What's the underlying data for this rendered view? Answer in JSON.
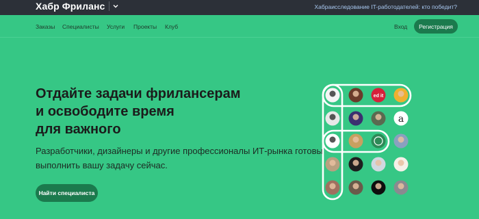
{
  "header": {
    "brand": "Хабр Фриланс",
    "top_link": "Хабраисследование IT-работодателей: кто победит?"
  },
  "nav": {
    "items": [
      "Заказы",
      "Специалисты",
      "Услуги",
      "Проекты",
      "Клуб"
    ],
    "login": "Вход",
    "register": "Регистрация"
  },
  "hero": {
    "headline": [
      "Отдайте задачи фрилансерам",
      "и освободите время",
      "для важного"
    ],
    "subtext": [
      "Разработчики, дизайнеры и другие профессионалы ИТ-рынка готовы",
      "выполнить вашу задачу сейчас."
    ],
    "cta": "Найти специалиста"
  },
  "avatars": [
    [
      "avatar",
      "avatar",
      "edit-logo",
      "avatar"
    ],
    [
      "avatar",
      "avatar",
      "avatar",
      "letter-a-logo"
    ],
    [
      "dog-avatar",
      "avatar",
      "spiral-logo",
      "avatar"
    ],
    [
      "avatar",
      "avatar",
      "cat-avatar",
      "avatar"
    ],
    [
      "avatar",
      "avatar",
      "avatar",
      "avatar"
    ]
  ],
  "avatar_logo_texts": {
    "edit": "ed it",
    "letter": "a"
  },
  "colors": {
    "background": "#36c785",
    "topbar": "#2c3038",
    "button": "#1b7a4d",
    "link": "#a8c8f0"
  }
}
